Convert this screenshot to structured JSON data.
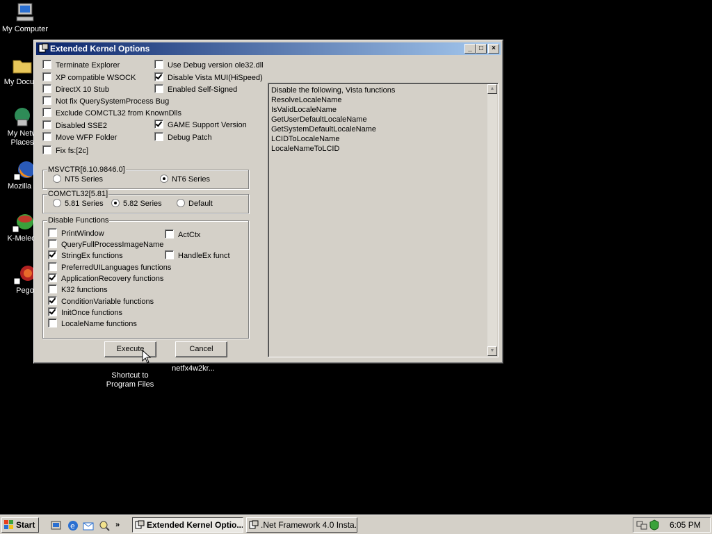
{
  "desktop": {
    "icons": [
      {
        "label": "My Computer"
      },
      {
        "label": "My Docum"
      },
      {
        "label_line1": "My Netw",
        "label_line2": "Places"
      },
      {
        "label": "Mozilla Fir"
      },
      {
        "label": "K-Meleon"
      },
      {
        "label": "Pego"
      },
      {
        "label_line1": "Shortcut to",
        "label_line2": "Program Files"
      },
      {
        "label": "netfx4w2kr..."
      }
    ]
  },
  "window": {
    "title": "Extended Kernel Options",
    "left_options": [
      {
        "label": "Terminate Explorer",
        "checked": false
      },
      {
        "label": "XP compatible WSOCK",
        "checked": false
      },
      {
        "label": "DirectX 10 Stub",
        "checked": false
      },
      {
        "label": "Not fix QuerySystemProcess Bug",
        "checked": false
      },
      {
        "label": "Exclude COMCTL32 from KnownDlls",
        "checked": false
      },
      {
        "label": "Disabled SSE2",
        "checked": false
      },
      {
        "label": "Move WFP Folder",
        "checked": false
      },
      {
        "label": "Fix fs:[2c]",
        "checked": false
      }
    ],
    "right_options": [
      {
        "label": "Use Debug version ole32.dll",
        "checked": false
      },
      {
        "label": "Disable Vista MUI(HiSpeed)",
        "checked": true
      },
      {
        "label": "Enabled Self-Signed",
        "checked": false
      },
      {
        "label": "GAME Support Version",
        "checked": true
      },
      {
        "label": "Debug Patch",
        "checked": false
      }
    ],
    "msvcrt": {
      "title": "MSVCTR[6.10.9846.0]",
      "options": [
        "NT5 Series",
        "NT6 Series"
      ],
      "selected": "NT6 Series"
    },
    "comctl": {
      "title": "COMCTL32[5.81]",
      "options": [
        "5.81 Series",
        "5.82 Series",
        "Default"
      ],
      "selected": "5.82 Series"
    },
    "disable_functions": {
      "title": "Disable Functions",
      "items": [
        {
          "label": "PrintWindow",
          "checked": false
        },
        {
          "label": "QueryFullProcessImageName",
          "checked": false
        },
        {
          "label": "StringEx functions",
          "checked": true
        },
        {
          "label": "PreferredUILanguages functions",
          "checked": false
        },
        {
          "label": "ApplicationRecovery functions",
          "checked": true
        },
        {
          "label": "K32 functions",
          "checked": false
        },
        {
          "label": "ConditionVariable functions",
          "checked": true
        },
        {
          "label": "InitOnce functions",
          "checked": true
        },
        {
          "label": "LocaleName functions",
          "checked": false
        }
      ],
      "side_items": [
        {
          "label": "ActCtx",
          "checked": false
        },
        {
          "label": "HandleEx funct",
          "checked": false
        }
      ]
    },
    "execute_label": "Execute",
    "cancel_label": "Cancel",
    "info_lines": [
      "Disable the following, Vista functions",
      "ResolveLocaleName",
      "IsValidLocaleName",
      "GetUserDefaultLocaleName",
      "GetSystemDefaultLocaleName",
      "LCIDToLocaleName",
      "LocaleNameToLCID"
    ]
  },
  "taskbar": {
    "start_label": "Start",
    "more_label": "»",
    "tasks": [
      {
        "label": "Extended Kernel Optio...",
        "active": true
      },
      {
        "label": ".Net Framework 4.0 Insta...",
        "active": false
      }
    ],
    "clock": "6:05 PM"
  }
}
